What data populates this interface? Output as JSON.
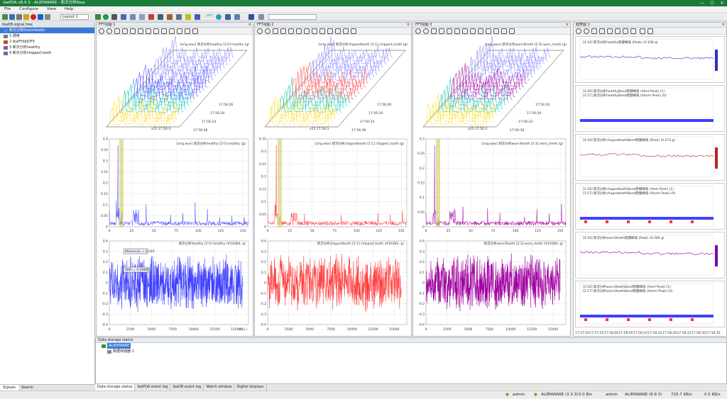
{
  "window": {
    "title": "ibaPDA v8.9.3  -  ALIENWARE  -  新次分析Naw",
    "controls": [
      "—",
      "☐",
      "✕"
    ]
  },
  "menu": [
    "File",
    "Configure",
    "View",
    "Help"
  ],
  "toolbar": {
    "layout": "Layout 1",
    "fft_label": "FFT"
  },
  "signal_tree": {
    "title": "ibaDB signal tree",
    "items": [
      {
        "label": "新次分析Exaimiteeth",
        "selected": true,
        "level": 0
      },
      {
        "label": "1  通用",
        "level": 0
      },
      {
        "label": "2  ibaFFdbIDF5",
        "level": 0
      },
      {
        "label": "3  新次分析healthy",
        "level": 0
      },
      {
        "label": "4  新次分析chipped tooth",
        "level": 0
      }
    ],
    "tabs": [
      "Signals",
      "Search"
    ]
  },
  "fft_panels": [
    {
      "title": "FFT视图 1",
      "legend": "[orig.wav] 新次分析healthy [2:0] healthy (g)",
      "color": "#4040ff",
      "times": [
        "17:56:26",
        "17:56:29",
        "17:56:33",
        "17:56:38"
      ],
      "cursor": "x25.17:56:3"
    },
    {
      "title": "FFT视图 2",
      "legend": "[orig.wav] 新次分析chippedtooth [2:1] chipped_tooth (g)",
      "color": "#ff4040",
      "times": [
        "17:56:26",
        "17:56:29",
        "17:56:33",
        "17:56:38"
      ],
      "cursor": "x25.17:56:3"
    },
    {
      "title": "FFT视图 3",
      "legend": "[orig.wav] 新次分析worn3teeth [2:3] worn_teeth (g)",
      "color": "#a000a0",
      "times": [
        "17:56:26",
        "17:56:29",
        "17:56:33",
        "17:56:38"
      ],
      "cursor": "x25.17:56:3"
    }
  ],
  "spectrum_legends": [
    "[orig.wav] 新次分析healthy [2:0] healthy (g)",
    "[orig.wav] 新次分析chippedtooth [2:1] chipped_tooth (g)",
    "[orig.wav] 新次分析worn3teeth [2:3] worn_teeth (g)"
  ],
  "time_legends": [
    "新次分析healthy [2:0] healthy (#16384, g)",
    "新次分析chippedtooth [2:1] chipped_tooth (#16384, g)",
    "新次分析worn3teeth [2:3] worn_teeth (#16384, g)"
  ],
  "time_boxes": [
    "Maximum = 0.319",
    "RMS = 0.09897"
  ],
  "trend": {
    "title": "趋势图 1",
    "rows": [
      {
        "legend": "[4:16] 新次分析healthy稳健峰值 (Peak) (0.108 g)"
      },
      {
        "legend": "[2:16] 新次分析healthyBand稳健峰值 (Alert Peak) (1)",
        "legend2": "[2:17] 新次分析healthyBand稳健峰值 (Alarm Peak) (0)"
      },
      {
        "legend": "[4:16] 新次分析chippedtoothBand稳健峰值 (Peak) (0.274 g)"
      },
      {
        "legend": "[2:16] 新次分析chippedtoothBand稳健峰值 (Alert Peak) (1)",
        "legend2": "[2:17] 新次分析chippedtoothBand稳健峰值 (Alarm Peak) (0)"
      },
      {
        "legend": "[4:16] 新次分析worn3teeth稳健峰值 (Peak) (0.269 g)"
      },
      {
        "legend": "[2:16] 新次分析worn3teethBand稳健峰值 (Alert Peak) (1)",
        "legend2": "[2:17] 新次分析worn3teethBand稳健峰值 (Alarm Peak) (0)"
      }
    ],
    "time_ticks": [
      "17:57:50",
      "17:57:55",
      "17:58:00",
      "17:58:05",
      "17:58:10",
      "17:58:15",
      "17:58:20",
      "17:58:25",
      "17:58:30",
      "17:58:35"
    ]
  },
  "storage": {
    "title": "Data storage status",
    "items": [
      "ALIENWARE",
      "数据存储器 1"
    ]
  },
  "bottom_tabs": [
    "Data storage status",
    "ibaPDA event log",
    "ibaDB event log",
    "Watch window",
    "Digital displays"
  ],
  "status": {
    "user1": "admin",
    "server1": "ALIENWARE (3.3.3)",
    "rate1": "0.0 B/s",
    "user2": "admin",
    "server2": "ALIENWARE (8.9.3)",
    "rate2": "729.7 KB/s",
    "rate3": "0.5 KB/s"
  },
  "chart_data": [
    {
      "type": "line",
      "title": "FFT spectrum",
      "series": [
        {
          "name": "[orig.wav] 新次分析healthy [2:0] healthy (g)"
        }
      ],
      "xticks": [
        "0",
        "25",
        "50",
        "75",
        "100",
        "125",
        "150"
      ],
      "yticks": [
        "0",
        "0.05",
        "0.1",
        "0.15",
        "0.2",
        "0.25",
        "0.3",
        "0.35",
        "0.4"
      ],
      "ylim": [
        0,
        0.4
      ]
    },
    {
      "type": "line",
      "title": "FFT spectrum",
      "series": [
        {
          "name": "[orig.wav] 新次分析chippedtooth [2:1] chipped_tooth (g)"
        }
      ],
      "xticks": [
        "0",
        "25",
        "50",
        "75",
        "100",
        "125",
        "150"
      ],
      "yticks": [
        "0",
        "0.05",
        "0.1",
        "0.15",
        "0.2",
        "0.25",
        "0.3",
        "0.35"
      ],
      "ylim": [
        0,
        0.35
      ]
    },
    {
      "type": "line",
      "title": "FFT spectrum",
      "series": [
        {
          "name": "[orig.wav] 新次分析worn3teeth [2:3] worn_teeth (g)"
        }
      ],
      "xticks": [
        "0",
        "25",
        "50",
        "75",
        "100",
        "125",
        "150"
      ],
      "yticks": [
        "0",
        "0.05",
        "0.1",
        "0.15",
        "0.2",
        "0.25",
        "0.3"
      ],
      "ylim": [
        0,
        0.3
      ]
    },
    {
      "type": "line",
      "title": "time signal",
      "xticks": [
        "0",
        "2500",
        "5000",
        "7500",
        "10000",
        "12500",
        "15000"
      ],
      "xlabel": "(No.)",
      "yticks": [
        "-0.4",
        "-0.3",
        "-0.2",
        "-0.1",
        "0",
        "0.1",
        "0.2",
        "0.3",
        "0.4"
      ],
      "ylim": [
        -0.4,
        0.4
      ]
    }
  ]
}
